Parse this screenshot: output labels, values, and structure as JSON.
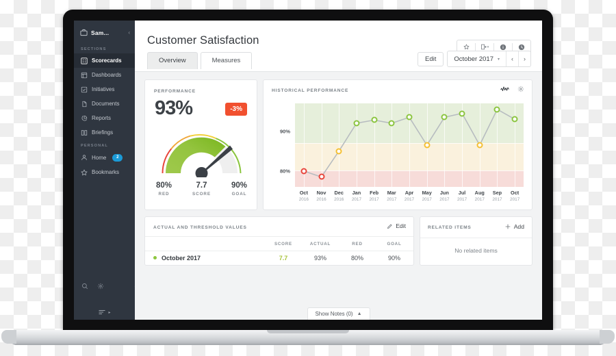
{
  "sidebar": {
    "workspace": "Sam...",
    "sections_label": "SECTIONS",
    "personal_label": "PERSONAL",
    "sections": [
      {
        "label": "Scorecards",
        "icon": "grid-icon",
        "active": true
      },
      {
        "label": "Dashboards",
        "icon": "dashboard-icon",
        "active": false
      },
      {
        "label": "Initiatives",
        "icon": "check-square-icon",
        "active": false
      },
      {
        "label": "Documents",
        "icon": "document-icon",
        "active": false
      },
      {
        "label": "Reports",
        "icon": "pie-chart-icon",
        "active": false
      },
      {
        "label": "Briefings",
        "icon": "book-icon",
        "active": false
      }
    ],
    "personal": [
      {
        "label": "Home",
        "icon": "user-icon",
        "badge": "2"
      },
      {
        "label": "Bookmarks",
        "icon": "star-icon",
        "badge": ""
      }
    ]
  },
  "header": {
    "title": "Customer Satisfaction",
    "tabs": [
      {
        "label": "Overview",
        "active": true
      },
      {
        "label": "Measures",
        "active": false
      }
    ],
    "edit_label": "Edit",
    "period": "October 2017",
    "icons": [
      "star-icon",
      "export-icon",
      "info-icon",
      "history-icon"
    ],
    "prev": "‹",
    "next": "›"
  },
  "performance": {
    "title": "PERFORMANCE",
    "value": "93%",
    "delta": "-3%",
    "delta_color": "#f1502f",
    "stats": [
      {
        "value": "80%",
        "label": "RED"
      },
      {
        "value": "7.7",
        "label": "SCORE"
      },
      {
        "value": "90%",
        "label": "GOAL"
      }
    ]
  },
  "historical": {
    "title": "HISTORICAL PERFORMANCE",
    "icons": [
      "sparkline-icon",
      "gear-icon"
    ]
  },
  "chart_data": {
    "type": "line",
    "title": "HISTORICAL PERFORMANCE",
    "xlabel": "",
    "ylabel": "",
    "ylim": [
      76,
      97
    ],
    "yticks": [
      80,
      90
    ],
    "ytick_labels": [
      "80%",
      "90%"
    ],
    "grid": true,
    "legend": "none",
    "categories": [
      "Oct 2016",
      "Nov 2016",
      "Dec 2016",
      "Jan 2017",
      "Feb 2017",
      "Mar 2017",
      "Apr 2017",
      "May 2017",
      "Jun 2017",
      "Jul 2017",
      "Aug 2017",
      "Sep 2017",
      "Oct 2017"
    ],
    "month_labels": [
      "Oct",
      "Nov",
      "Dec",
      "Jan",
      "Feb",
      "Mar",
      "Apr",
      "May",
      "Jun",
      "Jul",
      "Aug",
      "Sep",
      "Oct"
    ],
    "year_labels": [
      "2016",
      "2016",
      "2016",
      "2017",
      "2017",
      "2017",
      "2017",
      "2017",
      "2017",
      "2017",
      "2017",
      "2017",
      "2017"
    ],
    "values": [
      80,
      78.5,
      85,
      92,
      92.8,
      92,
      93.5,
      86.5,
      93.5,
      94.5,
      86.5,
      95.5,
      93
    ],
    "point_status": [
      "red",
      "red",
      "yellow",
      "green",
      "green",
      "green",
      "green",
      "yellow",
      "green",
      "green",
      "yellow",
      "green",
      "green"
    ],
    "status_colors": {
      "red": "#e8453c",
      "yellow": "#f5c033",
      "green": "#8bc53f"
    },
    "bands": [
      {
        "name": "green",
        "from": 90,
        "to": 97,
        "color": "#e6efdb"
      },
      {
        "name": "yellow",
        "from": 80,
        "to": 90,
        "color": "#faf1dd"
      },
      {
        "name": "red",
        "from": 76,
        "to": 80,
        "color": "#f7dcd9"
      }
    ],
    "line_color": "#b7bcc0"
  },
  "table": {
    "title": "ACTUAL AND THRESHOLD VALUES",
    "edit_label": "Edit",
    "columns": [
      "",
      "SCORE",
      "ACTUAL",
      "RED",
      "GOAL"
    ],
    "rows": [
      {
        "name": "October 2017",
        "score": "7.7",
        "actual": "93%",
        "red": "80%",
        "goal": "90%",
        "status_color": "#8dc63f"
      }
    ]
  },
  "related": {
    "title": "RELATED ITEMS",
    "add_label": "Add",
    "empty_text": "No related items"
  },
  "footer": {
    "notes_label": "Show Notes (0)"
  }
}
